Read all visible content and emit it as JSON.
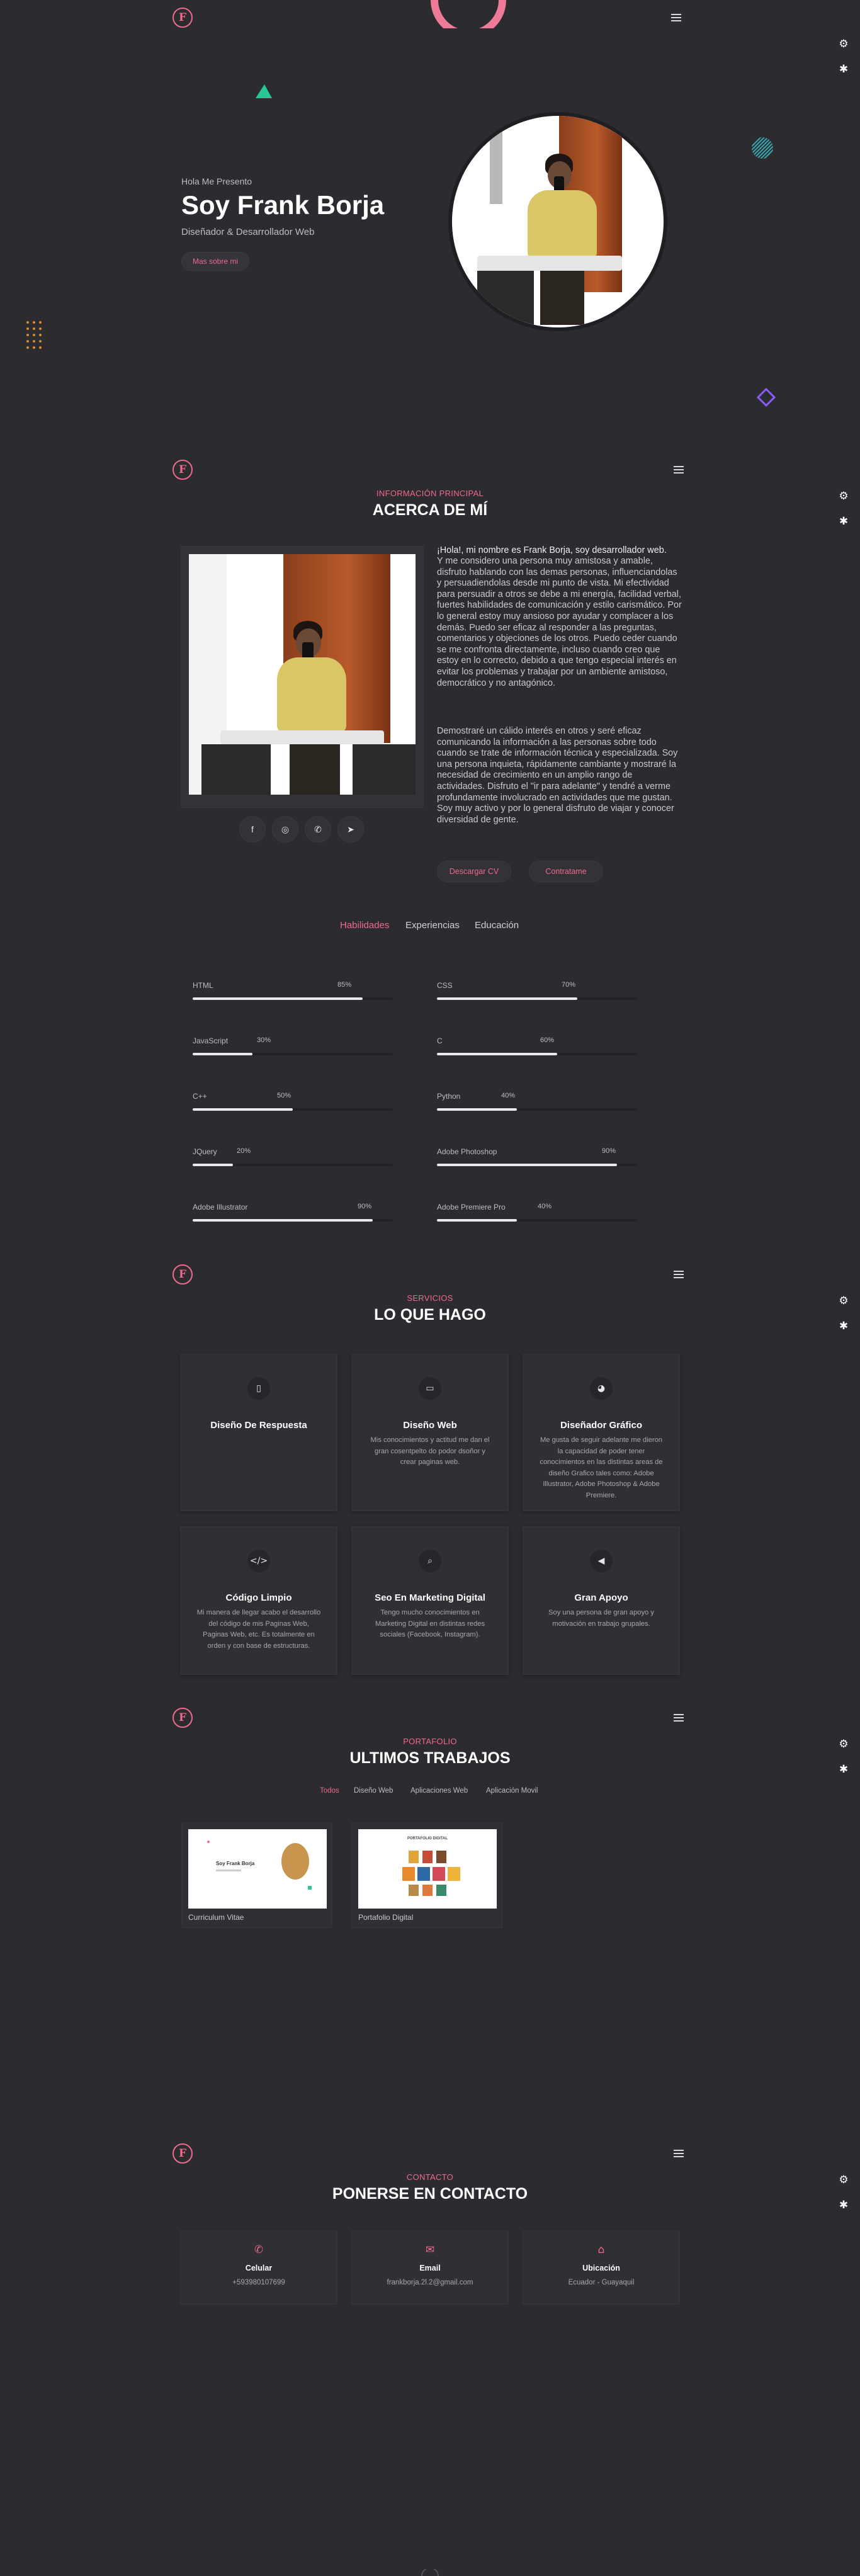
{
  "accent": "#ee6a8e",
  "background": "#2b2b30",
  "logo": "F",
  "hero": {
    "greeting": "Hola Me Presento",
    "name": "Soy Frank Borja",
    "role": "Diseñador & Desarrollador Web",
    "button": "Mas sobre mi"
  },
  "about": {
    "kicker": "INFORMACIÓN PRINCIPAL",
    "title": "ACERCA DE MÍ",
    "intro": "¡Hola!, mi nombre es Frank Borja, soy desarrollador web.",
    "p1": "Y me considero una persona muy amistosa y amable, disfruto hablando con las demas personas, influenciandolas y persuadiendolas desde mi punto de vista. Mi efectividad para persuadir a otros se debe a mi energía, facilidad verbal, fuertes habilidades de comunicación y estilo carismático. Por lo general estoy muy ansioso por ayudar y complacer a los demás. Puedo ser eficaz al responder a las preguntas, comentarios y objeciones de los otros. Puedo ceder cuando se me confronta directamente, incluso cuando creo que estoy en lo correcto, debido a que tengo especial interés en evitar los problemas y trabajar por un ambiente amistoso, democrático y no antagónico.",
    "p2": "Demostraré un cálido interés en otros y seré eficaz comunicando la información a las personas sobre todo cuando se trate de información técnica y especializada. Soy una persona inquieta, rápidamente cambiante y mostraré la necesidad de crecimiento en un amplio rango de actividades. Disfruto el \"ir para adelante\" y tendré a verme profundamente involucrado en actividades que me gustan. Soy muy activo y por lo general disfruto de viajar y conocer diversidad de gente.",
    "socials": [
      "facebook-icon",
      "instagram-icon",
      "whatsapp-icon",
      "telegram-icon"
    ],
    "download_cv": "Descargar CV",
    "hire": "Contratame"
  },
  "tabs": [
    "Habilidades",
    "Experiencias",
    "Educación"
  ],
  "skills": [
    {
      "name": "HTML",
      "pct": "85%",
      "value": 0.85
    },
    {
      "name": "CSS",
      "pct": "70%",
      "value": 0.7
    },
    {
      "name": "JavaScript",
      "pct": "30%",
      "value": 0.3
    },
    {
      "name": "C",
      "pct": "60%",
      "value": 0.6
    },
    {
      "name": "C++",
      "pct": "50%",
      "value": 0.5
    },
    {
      "name": "Python",
      "pct": "40%",
      "value": 0.4
    },
    {
      "name": "JQuery",
      "pct": "20%",
      "value": 0.2
    },
    {
      "name": "Adobe Photoshop",
      "pct": "90%",
      "value": 0.9
    },
    {
      "name": "Adobe Illustrator",
      "pct": "90%",
      "value": 0.9
    },
    {
      "name": "Adobe Premiere Pro",
      "pct": "40%",
      "value": 0.4
    }
  ],
  "services": {
    "kicker": "SERVICIOS",
    "title": "LO QUE HAGO",
    "items": [
      {
        "icon": "mobile-icon",
        "title": "Diseño De Respuesta",
        "desc": ""
      },
      {
        "icon": "laptop-icon",
        "title": "Diseño Web",
        "desc": "Mis conocimientos y actitud me dan el gran cosentpelto do podor dsoñor y crear paginas web."
      },
      {
        "icon": "palette-icon",
        "title": "Diseñador Gráfico",
        "desc": "Me gusta de seguir adelante me dieron la capacidad de poder tener conocimientos en las distintas areas de diseño Grafico tales como: Adobe Illustrator, Adobe Photoshop & Adobe Premiere."
      },
      {
        "icon": "code-icon",
        "title": "Código Limpio",
        "desc": "Mi manera de llegar acabo el desarrollo del código de mis Paginas Web, Paginas Web, etc. Es totalmente en orden y con base de estructuras."
      },
      {
        "icon": "search-icon",
        "title": "Seo En Marketing Digital",
        "desc": "Tengo mucho conocimientos en Marketing Digital en distintas redes sociales (Facebook, Instagram)."
      },
      {
        "icon": "megaphone-icon",
        "title": "Gran Apoyo",
        "desc": "Soy una persona de gran apoyo y motivación en trabajo grupales."
      }
    ]
  },
  "portfolio": {
    "kicker": "PORTAFOLIO",
    "title": "ULTIMOS TRABAJOS",
    "filters": [
      "Todos",
      "Diseño Web",
      "Aplicaciones Web",
      "Aplicación Movil"
    ],
    "works": [
      {
        "label": "Curriculum Vitae",
        "thumb_title": "Soy Frank Borja"
      },
      {
        "label": "Portafolio Digital",
        "thumb_title": "PORTAFOLIO DIGITAL"
      }
    ]
  },
  "contact": {
    "kicker": "CONTACTO",
    "title": "PONERSE EN CONTACTO",
    "items": [
      {
        "icon": "phone-icon",
        "title": "Celular",
        "value": "+593980107699"
      },
      {
        "icon": "email-icon",
        "title": "Email",
        "value": "frankborja.2l.2@gmail.com"
      },
      {
        "icon": "location-icon",
        "title": "Ubicación",
        "value": "Ecuador - Guayaquil"
      }
    ]
  }
}
